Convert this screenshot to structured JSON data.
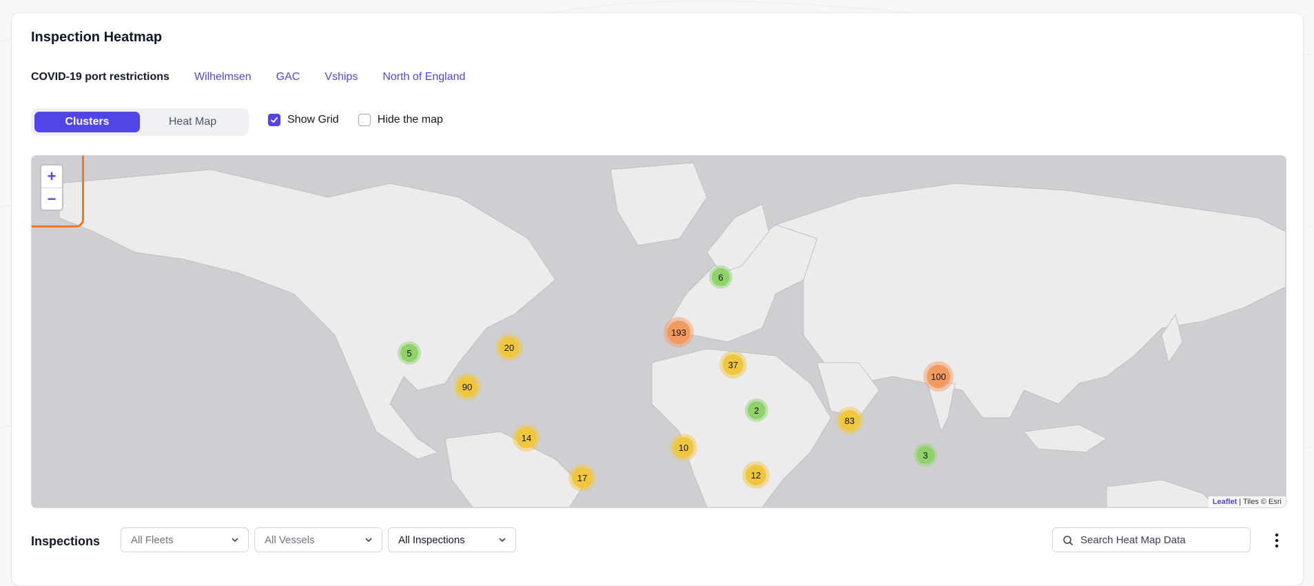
{
  "header": {
    "title": "Inspection Heatmap"
  },
  "port_restrictions": {
    "label": "COVID-19 port restrictions",
    "links": [
      "Wilhelmsen",
      "GAC",
      "Vships",
      "North of England"
    ]
  },
  "view_toggle": {
    "clusters": "Clusters",
    "heatmap": "Heat Map",
    "active": "clusters"
  },
  "options": {
    "show_grid": "Show Grid",
    "hide_map": "Hide the map",
    "show_grid_checked": true,
    "hide_map_checked": false
  },
  "map": {
    "zoom_in": "+",
    "zoom_out": "−",
    "attribution_link": "Leaflet",
    "attribution_text": " | Tiles © Esri",
    "clusters": [
      {
        "count": "6",
        "level": "low"
      },
      {
        "count": "193",
        "level": "high"
      },
      {
        "count": "5",
        "level": "low"
      },
      {
        "count": "20",
        "level": "mid"
      },
      {
        "count": "90",
        "level": "mid"
      },
      {
        "count": "37",
        "level": "mid"
      },
      {
        "count": "100",
        "level": "high"
      },
      {
        "count": "2",
        "level": "low"
      },
      {
        "count": "83",
        "level": "mid"
      },
      {
        "count": "14",
        "level": "mid"
      },
      {
        "count": "10",
        "level": "mid"
      },
      {
        "count": "3",
        "level": "low"
      },
      {
        "count": "12",
        "level": "mid"
      },
      {
        "count": "17",
        "level": "mid"
      }
    ]
  },
  "colors": {
    "accent": "#4f46e5",
    "highlight": "#f97316",
    "low": "#8fd26a",
    "mid": "#f0c63c",
    "high": "#f39a5e"
  },
  "inspections": {
    "label": "Inspections",
    "fleets": "All Fleets",
    "vessels": "All Vessels",
    "types": "All Inspections",
    "search_placeholder": "Search Heat Map Data"
  }
}
